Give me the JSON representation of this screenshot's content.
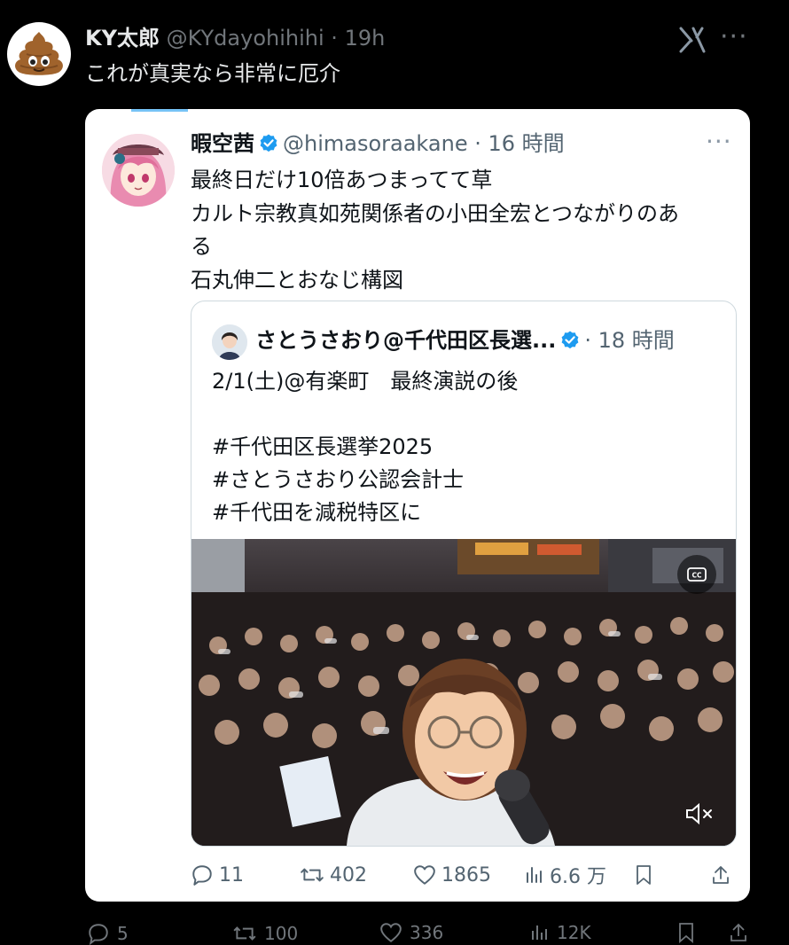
{
  "outer_tweet": {
    "display_name": "KY太郎",
    "handle": "@KYdayohihihi",
    "separator": "·",
    "time": "19h",
    "text": "これが真実なら非常に厄介",
    "avatar_icon": "poop-emoji-icon",
    "more_label": "···"
  },
  "quoted_tweet": {
    "display_name": "暇空茜",
    "handle": "@himasoraakane",
    "separator": "·",
    "time": "16 時間",
    "more_label": "···",
    "lines": [
      "最終日だけ10倍あつまってて草",
      "カルト宗教真如苑関係者の小田全宏とつながりのあ",
      "る",
      "石丸伸二とおなじ構図"
    ],
    "verified_color": "#1d9bf0"
  },
  "nested_quote": {
    "display_name": "さとうさおり@千代田区長選...",
    "separator": "·",
    "time": "18 時間",
    "lines": [
      "2/1(土)@有楽町　最終演説の後",
      "",
      "#千代田区長選挙2025",
      "#さとうさおり公認会計士",
      "#千代田を減税特区に"
    ],
    "video": {
      "cc_label": "CC",
      "mute_icon": "speaker-muted-icon"
    }
  },
  "actions": {
    "replies": "11",
    "reposts": "402",
    "likes": "1865",
    "views": "6.6 万"
  },
  "bottom_actions": {
    "replies": "5",
    "reposts": "100",
    "likes": "336",
    "views": "12K"
  }
}
